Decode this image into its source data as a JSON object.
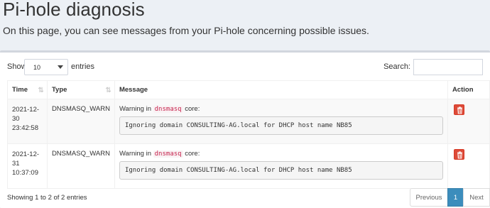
{
  "header": {
    "title": "Pi-hole diagnosis",
    "subtitle": "On this page, you can see messages from your Pi-hole concerning possible issues."
  },
  "controls": {
    "show_label": "Show",
    "length_value": "10",
    "entries_label": "entries",
    "search_label": "Search:",
    "search_value": ""
  },
  "table": {
    "columns": [
      "Time",
      "Type",
      "Message",
      "Action"
    ],
    "rows": [
      {
        "time_date": "2021-12-",
        "time_day": "30",
        "time_clock": "23:42:58",
        "type": "DNSMASQ_WARN",
        "warn_prefix": "Warning in",
        "warn_code": "dnsmasq",
        "warn_suffix": "core:",
        "message": "Ignoring domain CONSULTING-AG.local for DHCP host name NB85"
      },
      {
        "time_date": "2021-12-",
        "time_day": "31",
        "time_clock": "10:37:09",
        "type": "DNSMASQ_WARN",
        "warn_prefix": "Warning in",
        "warn_code": "dnsmasq",
        "warn_suffix": "core:",
        "message": "Ignoring domain CONSULTING-AG.local for DHCP host name NB85"
      }
    ]
  },
  "footer": {
    "info": "Showing 1 to 2 of 2 entries",
    "previous": "Previous",
    "page": "1",
    "next": "Next"
  },
  "colors": {
    "accent": "#3c8dbc",
    "danger": "#dd4b39",
    "code": "#c7254e"
  },
  "icons": {
    "length_select": "chevron-down-icon",
    "sort": "sort-icon",
    "delete": "trash-icon"
  }
}
